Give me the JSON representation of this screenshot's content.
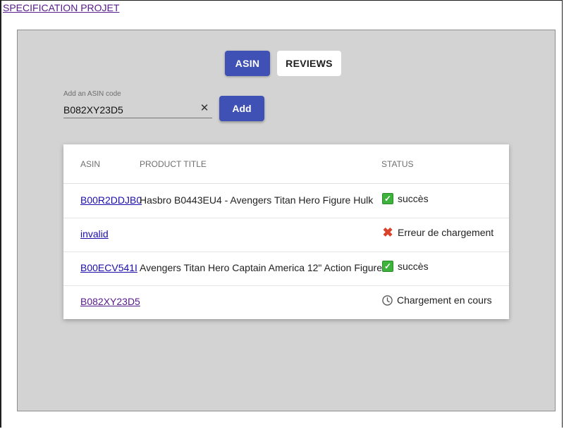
{
  "header": {
    "spec_link": "SPECIFICATION PROJET"
  },
  "tabs": [
    {
      "label": "ASIN",
      "active": true
    },
    {
      "label": "REVIEWS",
      "active": false
    }
  ],
  "asin_form": {
    "label": "Add an ASIN code",
    "value": "B082XY23D5",
    "clear_icon": "close-icon",
    "add_label": "Add"
  },
  "table": {
    "headers": {
      "asin": "ASIN",
      "title": "PRODUCT TITLE",
      "status": "STATUS"
    },
    "rows": [
      {
        "asin": "B00R2DDJB0",
        "title": "Hasbro B0443EU4 - Avengers Titan Hero Figure Hulk",
        "status": "succès",
        "icon": "check-icon"
      },
      {
        "asin": "invalid",
        "title": "",
        "status": "Erreur de chargement",
        "icon": "cross-icon"
      },
      {
        "asin": "B00ECV541I",
        "title": "Avengers Titan Hero Captain America 12\" Action Figure",
        "status": "succès",
        "icon": "check-icon"
      },
      {
        "asin": "B082XY23D5",
        "title": "",
        "status": "Chargement en cours",
        "icon": "clock-icon"
      }
    ]
  },
  "colors": {
    "primary": "#3f51b5",
    "panel_bg": "#d3d3d3",
    "success": "#3db33d",
    "error": "#d9422b"
  }
}
